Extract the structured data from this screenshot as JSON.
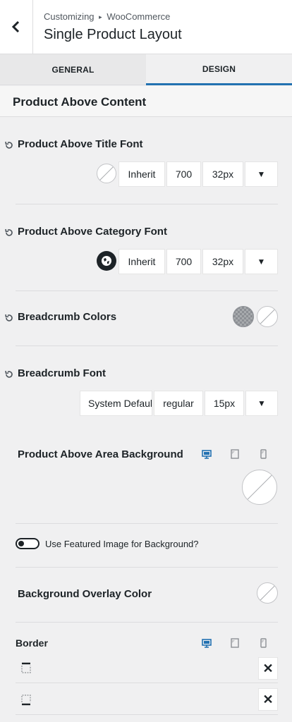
{
  "header": {
    "breadcrumb_parent": "Customizing",
    "breadcrumb_separator": "▸",
    "breadcrumb_child": "WooCommerce",
    "title": "Single Product Layout"
  },
  "tabs": {
    "general": "GENERAL",
    "design": "DESIGN",
    "active": "DESIGN"
  },
  "section": {
    "title": "Product Above Content"
  },
  "title_font": {
    "label": "Product Above Title Font",
    "family": "Inherit",
    "weight": "700",
    "size": "32px"
  },
  "category_font": {
    "label": "Product Above Category Font",
    "family": "Inherit",
    "weight": "700",
    "size": "32px"
  },
  "breadcrumb_colors": {
    "label": "Breadcrumb Colors"
  },
  "breadcrumb_font": {
    "label": "Breadcrumb Font",
    "family": "System Default",
    "weight": "regular",
    "size": "15px"
  },
  "area_background": {
    "label": "Product Above Area Background"
  },
  "featured_image": {
    "label": "Use Featured Image for Background?",
    "enabled": false
  },
  "overlay_color": {
    "label": "Background Overlay Color"
  },
  "border": {
    "label": "Border"
  },
  "colors": {
    "accent": "#2271b1",
    "text": "#1d2327",
    "panel_bg": "#f0f0f1"
  },
  "icons": [
    "chevron-left-icon",
    "reset-icon",
    "globe-icon",
    "desktop-icon",
    "tablet-icon",
    "mobile-icon",
    "border-top-icon",
    "border-bottom-icon",
    "close-icon"
  ]
}
